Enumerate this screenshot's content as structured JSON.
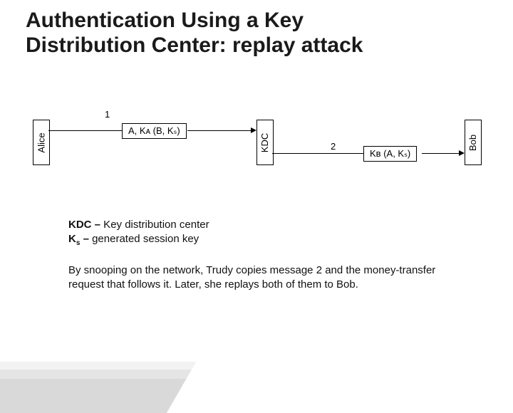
{
  "title_line1": "Authentication Using a Key",
  "title_line2": "Distribution Center: replay attack",
  "actors": {
    "alice": "Alice",
    "kdc": "KDC",
    "bob": "Bob"
  },
  "messages": {
    "num1": "1",
    "msg1": "A, Kᴀ (B, Kₛ)",
    "num2": "2",
    "msg2": "Kʙ (A, Kₛ)"
  },
  "definitions": {
    "kdc_label": "KDC –",
    "kdc_def": " Key distribution center",
    "ks_label": "K",
    "ks_sub": "s",
    "ks_dash": " –",
    "ks_def": " generated session key"
  },
  "explain": "By snooping on the network, Trudy copies message 2 and the money-transfer request that follows it. Later, she replays both of them to Bob.",
  "chart_data": {
    "type": "diagram",
    "actors": [
      "Alice",
      "KDC",
      "Bob"
    ],
    "messages": [
      {
        "step": 1,
        "from": "Alice",
        "to": "KDC",
        "payload": "A, K_A(B, K_S)"
      },
      {
        "step": 2,
        "from": "KDC",
        "to": "Bob",
        "payload": "K_B(A, K_S)"
      }
    ],
    "legend": {
      "KDC": "Key distribution center",
      "K_s": "generated session key"
    },
    "note": "By snooping on the network, Trudy copies message 2 and the money-transfer request that follows it. Later, she replays both of them to Bob."
  }
}
